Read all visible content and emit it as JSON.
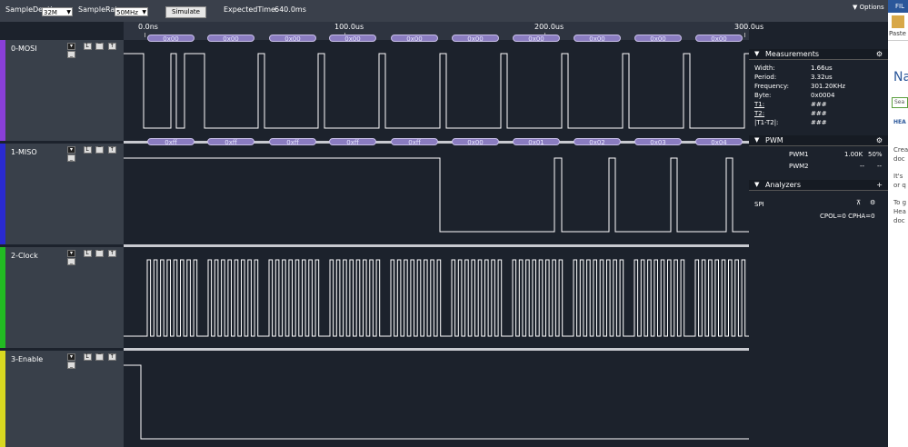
{
  "toolbar": {
    "sample_depth_label": "SampleDepth",
    "sample_depth_value": "32M",
    "sample_rate_label": "SampleRate",
    "sample_rate_value": "50MHz",
    "simulate_label": "Simulate",
    "expected_label": "ExpectedTime:",
    "expected_value": "640.0ms",
    "options_label": "Options"
  },
  "ruler": {
    "ticks": [
      "0.0ns",
      "100.0us",
      "200.0us",
      "300.0us"
    ]
  },
  "channels": [
    {
      "label": "0-MOSI",
      "color": "#8a3fd8"
    },
    {
      "label": "1-MISO",
      "color": "#2a2ad0"
    },
    {
      "label": "2-Clock",
      "color": "#22bb22"
    },
    {
      "label": "3-Enable",
      "color": "#d8d820"
    }
  ],
  "decode": {
    "mosi": [
      "0x00",
      "0x00",
      "0x00",
      "0x00",
      "0x00",
      "0x00",
      "0x00",
      "0x00",
      "0x00",
      "0x00"
    ],
    "miso": [
      "0xff",
      "0xff",
      "0xff",
      "0xff",
      "0xff",
      "0x00",
      "0x01",
      "0x02",
      "0x03",
      "0x04"
    ]
  },
  "measurements": {
    "title": "Measurements",
    "rows": [
      {
        "label": "Width:",
        "value": "1.66us"
      },
      {
        "label": "Period:",
        "value": "3.32us"
      },
      {
        "label": "Frequency:",
        "value": "301.20KHz"
      },
      {
        "label": "Byte:",
        "value": "0x0004"
      },
      {
        "label": "T1:",
        "value": "###"
      },
      {
        "label": "T2:",
        "value": "###"
      },
      {
        "label": "|T1-T2|:",
        "value": "###"
      }
    ]
  },
  "pwm": {
    "title": "PWM",
    "rows": [
      {
        "name": "PWM1",
        "freq": "1.00K",
        "duty": "50%"
      },
      {
        "name": "PWM2",
        "freq": "--",
        "duty": "--"
      }
    ]
  },
  "analyzers": {
    "title": "Analyzers",
    "name": "SPI",
    "settings": "CPOL=0 CPHA=0"
  },
  "word": {
    "tab": "FIL",
    "paste": "Paste",
    "style_head": "Na",
    "search": "Sea",
    "heading": "HEA",
    "p1a": "Crea",
    "p1b": "doc",
    "p2a": "It's",
    "p2b": "or q",
    "p3a": "To g",
    "p3b": "Hea",
    "p3c": "doc"
  }
}
